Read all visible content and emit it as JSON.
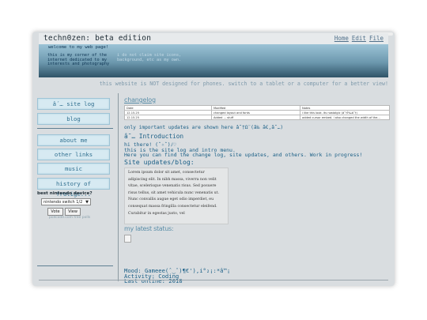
{
  "header": {
    "site_title": "techn0zen: beta edition",
    "menu": [
      "Home",
      "Edit",
      "File"
    ]
  },
  "banner": {
    "welcome": "welcome to my web page!",
    "intro": "this is my corner of the internet dedicated to my interests and photography",
    "claim": "i do not claim site icons, background, etc as my own."
  },
  "notice": "this website is NOT designed for phones. switch to a tablet or a computer for a better view!",
  "sidebar": {
    "items": [
      {
        "label": "â´… site log"
      },
      {
        "label": "blog"
      },
      {
        "label": "about me"
      },
      {
        "label": "other links"
      },
      {
        "label": "music"
      },
      {
        "label": "history of frutige..."
      }
    ],
    "poll": {
      "question": "best nintendo device?",
      "selected": "nintendo switch 1/2",
      "vote_label": "Vote",
      "view_label": "View",
      "footer": "pollcode.com free polls"
    }
  },
  "main": {
    "changelog_heading": "changelog",
    "changelog_table": {
      "headers": [
        "Date",
        "Modified",
        "Notes"
      ],
      "rows": [
        [
          "12.15.25",
          "changed layout and fonts",
          "i like this look. its nostalgic (â˜†Ï‰â˜†)"
        ],
        [
          "12.15.25",
          "Added ... stuff",
          "added cursor embed. i also changed the width of the..."
        ]
      ]
    },
    "changelog_note": "only important updates are shown here â˜†Ω¨(â‰  ã€‚â˜…)",
    "intro_heading": "â˜… Introduction",
    "greeting": [
      "hi there! (ˆ✧ˆ)ﾉ♡",
      "this is the site log and intro menu.",
      "Here you can find the change log, site updates, and others. Work in progress!"
    ],
    "updates_heading": "Site updates/blog:",
    "lorem": "Lorem ipsum dolor sit amet, consectetur adipiscing elit. In nibh massa, viverra non velit vitae, scelerisque venenatis risus. Sed posuere risus tellus, sit amet vehicula nunc venenatis ut. Nunc convallis augue eget odio imperdiet, eu consequat massa fringilla consectetur eleifend. Curabitur in egestas justo, vel",
    "status_heading": "my latest status:",
    "status": {
      "mood": "Mood: Gameee(ˆ‿ˆ)¶€'),i°₂¡:*â™¡",
      "activity": "Activity: Coding",
      "last_online": "Last online: 2018"
    }
  }
}
